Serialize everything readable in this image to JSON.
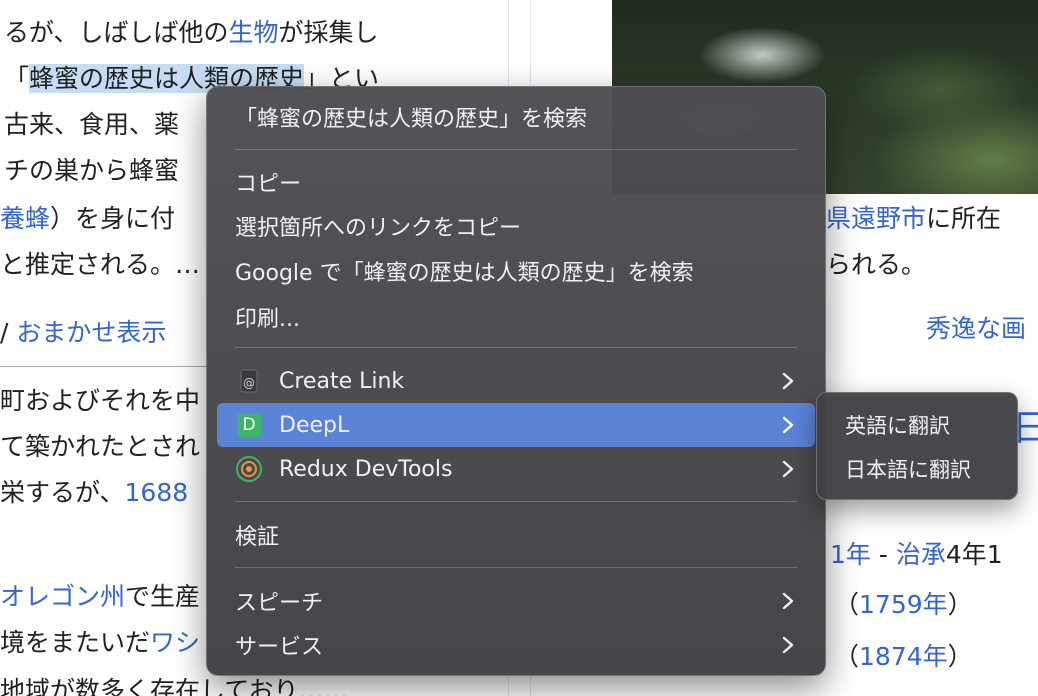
{
  "background": {
    "left_col": {
      "lines": [
        {
          "parts": [
            {
              "t": "るが、しばしば他の",
              "c": "text"
            },
            {
              "t": "生物",
              "c": "link"
            },
            {
              "t": "が採集し",
              "c": "text"
            }
          ]
        },
        {
          "parts": [
            {
              "t": "「",
              "c": "text"
            },
            {
              "t": "蜂蜜の歴史は人類の歴史",
              "c": "hl"
            },
            {
              "t": "」とい",
              "c": "text"
            }
          ]
        },
        {
          "parts": [
            {
              "t": "古来、食用、薬",
              "c": "text"
            }
          ]
        },
        {
          "parts": [
            {
              "t": "チの巣から蜂蜜",
              "c": "text"
            }
          ]
        },
        {
          "parts": [
            {
              "t": "養蜂",
              "c": "link"
            },
            {
              "t": "）を身に付",
              "c": "text"
            }
          ]
        },
        {
          "parts": [
            {
              "t": "と推定される。…",
              "c": "text"
            }
          ]
        },
        {
          "parts": [
            {
              "t": "/ ",
              "c": "text"
            },
            {
              "t": "おまかせ表示",
              "c": "link"
            }
          ]
        },
        {
          "parts": [
            {
              "t": "町およびそれを中",
              "c": "text"
            }
          ]
        },
        {
          "parts": [
            {
              "t": "て築かれたとされ",
              "c": "text"
            }
          ]
        },
        {
          "parts": [
            {
              "t": "栄するが、",
              "c": "text"
            },
            {
              "t": "1688",
              "c": "link"
            }
          ]
        },
        {
          "parts": [
            {
              "t": "",
              "c": "text"
            }
          ]
        },
        {
          "parts": [
            {
              "t": "オレゴン州",
              "c": "link"
            },
            {
              "t": "で生産",
              "c": "text"
            }
          ]
        },
        {
          "parts": [
            {
              "t": "境をまたいだ",
              "c": "text"
            },
            {
              "t": "ワシ",
              "c": "link"
            }
          ]
        },
        {
          "parts": [
            {
              "t": "地域が数多く存在しており……",
              "c": "text"
            }
          ]
        }
      ]
    },
    "right_col": {
      "lines": [
        {
          "parts": [
            {
              "t": "県遠野市",
              "c": "link"
            },
            {
              "t": "に所在",
              "c": "text"
            }
          ]
        },
        {
          "parts": [
            {
              "t": "られる。",
              "c": "text"
            }
          ]
        },
        {
          "parts": [
            {
              "t": "秀逸な画",
              "c": "link"
            }
          ]
        },
        {
          "parts": [
            {
              "t": "日",
              "c": "link"
            }
          ]
        },
        {
          "parts": [
            {
              "t": "1年",
              "c": "link"
            },
            {
              "t": " - ",
              "c": "text"
            },
            {
              "t": "治承",
              "c": "link"
            },
            {
              "t": "4年1",
              "c": "text"
            }
          ]
        },
        {
          "parts": [
            {
              "t": "（",
              "c": "text"
            },
            {
              "t": "1759年",
              "c": "link"
            },
            {
              "t": "）",
              "c": "text"
            }
          ]
        },
        {
          "parts": [
            {
              "t": "（",
              "c": "text"
            },
            {
              "t": "1874年",
              "c": "link"
            },
            {
              "t": "）",
              "c": "text"
            }
          ]
        }
      ]
    }
  },
  "context_menu": {
    "search_selection": "「蜂蜜の歴史は人類の歴史」を検索",
    "copy": "コピー",
    "copy_link_to_highlight": "選択箇所へのリンクをコピー",
    "search_google": "Google で「蜂蜜の歴史は人類の歴史」を検索",
    "print": "印刷...",
    "create_link": "Create Link",
    "deepl": "DeepL",
    "deepl_icon_letter": "D",
    "redux_devtools": "Redux DevTools",
    "inspect": "検証",
    "speech": "スピーチ",
    "services": "サービス",
    "active_item": "DeepL",
    "active_color": "#5b84d6"
  },
  "submenu": {
    "translate_english": "英語に翻訳",
    "translate_japanese": "日本語に翻訳"
  },
  "colors": {
    "link": "#3366cc",
    "highlight": "#c6dcf5",
    "deepl_green": "#3fb36a"
  }
}
